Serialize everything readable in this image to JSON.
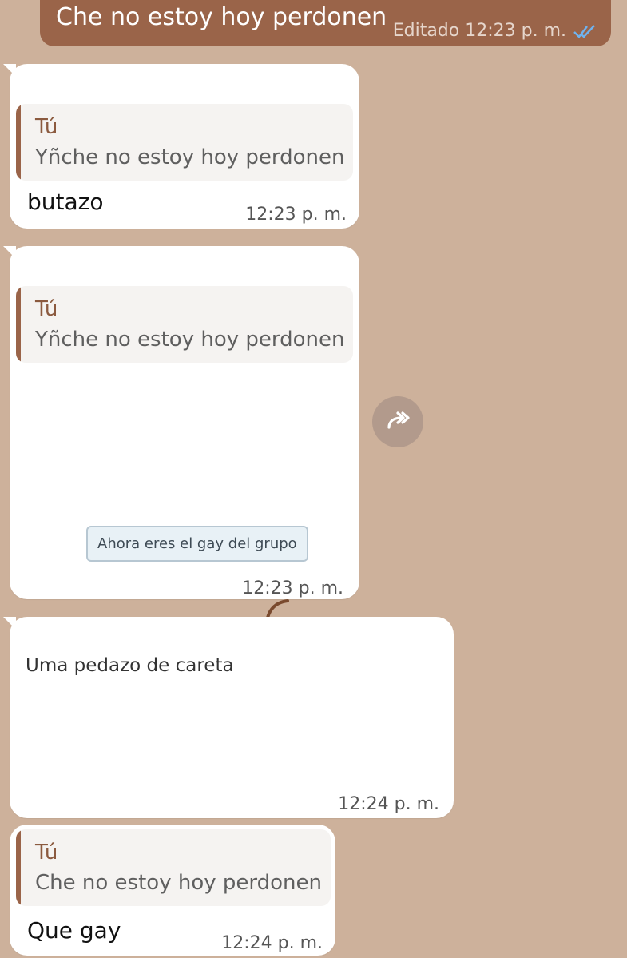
{
  "outgoing": {
    "text": "Che no estoy hoy perdonen",
    "meta": "Editado 12:23 p. m."
  },
  "messages": [
    {
      "quote_name": "Tú",
      "quote_text": "Yñche no estoy hoy perdonen",
      "text": "butazo",
      "time": "12:23 p. m."
    },
    {
      "quote_name": "Tú",
      "quote_text": "Yñche no estoy hoy perdonen",
      "sticker_text": "Ahora eres el gay del grupo",
      "time": "12:23 p. m."
    },
    {
      "text": "Uma pedazo de careta",
      "time": "12:24 p. m."
    },
    {
      "quote_name": "Tú",
      "quote_text": "Che no estoy hoy perdonen",
      "text": "Que gay",
      "time": "12:24 p. m."
    }
  ],
  "icons": {
    "forward": "forward-icon",
    "read_receipt": "double-check-icon"
  },
  "colors": {
    "background": "#cdb19b",
    "outgoing_bubble": "#9a6449",
    "incoming_bubble": "#ffffff",
    "quote_bar": "#9a6449",
    "read_ticks": "#6fb3f0"
  }
}
